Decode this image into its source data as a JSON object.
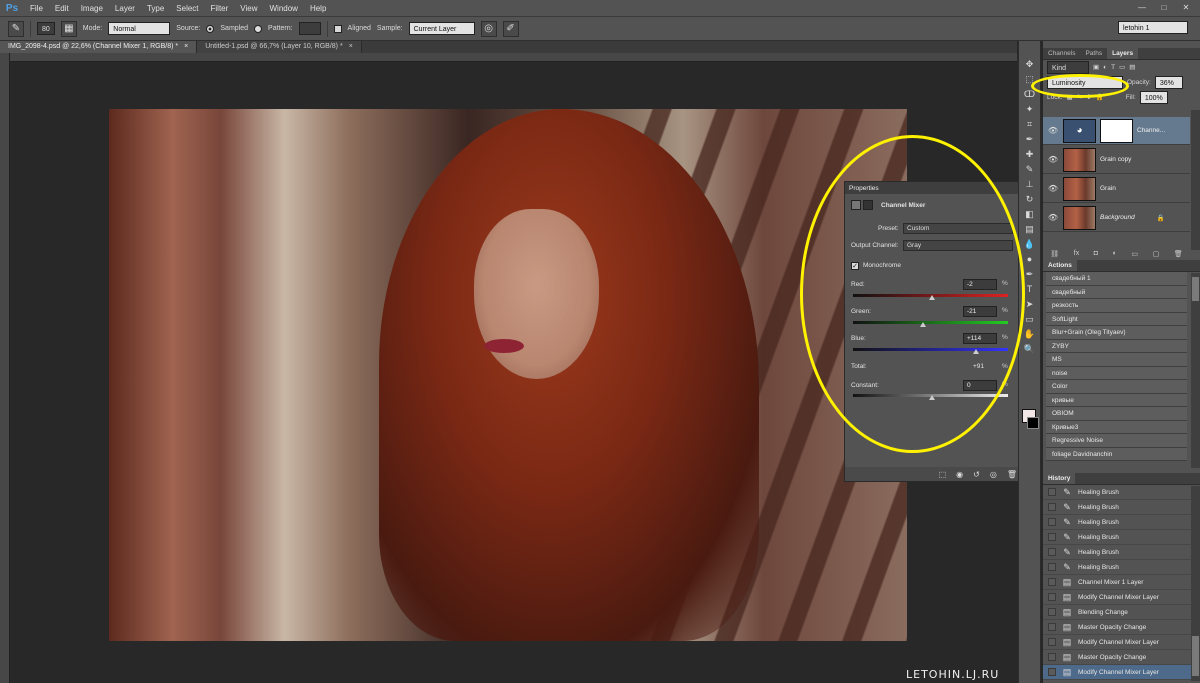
{
  "menubar": {
    "logo": "Ps",
    "items": [
      "File",
      "Edit",
      "Image",
      "Layer",
      "Type",
      "Select",
      "Filter",
      "View",
      "Window",
      "Help"
    ]
  },
  "options": {
    "brush_size": "80",
    "mode_label": "Mode:",
    "mode_value": "Normal",
    "source_label": "Source:",
    "sampled_label": "Sampled",
    "pattern_label": "Pattern:",
    "aligned_label": "Aligned",
    "sample_label": "Sample:",
    "sample_value": "Current Layer",
    "workspace": "letohin 1"
  },
  "doc_tabs": [
    {
      "title": "IMG_2098-4.psd @ 22,6% (Channel Mixer 1, RGB/8) *",
      "close": "×"
    },
    {
      "title": "Untitled-1.psd @ 66,7% (Layer 10, RGB/8) *",
      "close": "×"
    }
  ],
  "watermark": "LETOHIN.LJ.RU",
  "layers_panel": {
    "tabs": [
      "Channels",
      "Paths",
      "Layers"
    ],
    "kind": "Kind",
    "blend_mode": "Luminosity",
    "opacity_label": "Opacity:",
    "opacity_value": "36%",
    "lock_label": "Lock:",
    "fill_label": "Fill:",
    "fill_value": "100%",
    "layers": [
      {
        "name": "Channe...",
        "type": "adjustment",
        "selected": true
      },
      {
        "name": "Grain copy",
        "type": "photo",
        "selected": false
      },
      {
        "name": "Grain",
        "type": "photo",
        "selected": false
      },
      {
        "name": "Background",
        "type": "photo",
        "selected": false,
        "locked": true
      }
    ]
  },
  "actions_panel": {
    "title": "Actions",
    "items": [
      "свадебный 1",
      "свадебный",
      "резкость",
      "SoftLight",
      "Blur+Grain (Oleg Tityaev)",
      "ZYBY",
      "MS",
      "noise",
      "Color",
      "кривые",
      "OBIOM",
      "Кривые3",
      "Regressive Noise",
      "foliage Davidnanchin"
    ]
  },
  "history_panel": {
    "title": "History",
    "items": [
      {
        "label": "Healing Brush",
        "icon": "brush-icon"
      },
      {
        "label": "Healing Brush",
        "icon": "brush-icon"
      },
      {
        "label": "Healing Brush",
        "icon": "brush-icon"
      },
      {
        "label": "Healing Brush",
        "icon": "brush-icon"
      },
      {
        "label": "Healing Brush",
        "icon": "brush-icon"
      },
      {
        "label": "Healing Brush",
        "icon": "brush-icon"
      },
      {
        "label": "Channel Mixer 1 Layer",
        "icon": "document-icon"
      },
      {
        "label": "Modify Channel Mixer Layer",
        "icon": "document-icon"
      },
      {
        "label": "Blending Change",
        "icon": "document-icon"
      },
      {
        "label": "Master Opacity Change",
        "icon": "document-icon"
      },
      {
        "label": "Modify Channel Mixer Layer",
        "icon": "document-icon"
      },
      {
        "label": "Master Opacity Change",
        "icon": "document-icon"
      },
      {
        "label": "Modify Channel Mixer Layer",
        "icon": "document-icon",
        "selected": true
      }
    ]
  },
  "properties_panel": {
    "title": "Properties",
    "adjustment": "Channel Mixer",
    "preset_label": "Preset:",
    "preset_value": "Custom",
    "output_label": "Output Channel:",
    "output_value": "Gray",
    "monochrome_label": "Monochrome",
    "monochrome_checked": true,
    "red_label": "Red:",
    "red_value": "-2",
    "green_label": "Green:",
    "green_value": "-21",
    "blue_label": "Blue:",
    "blue_value": "+114",
    "total_label": "Total:",
    "total_value": "+91",
    "constant_label": "Constant:",
    "constant_value": "0",
    "pct": "%"
  },
  "colors": {
    "highlight_circle": "#fff200",
    "selection_blue": "#667a8f",
    "ui_bg": "#535353"
  }
}
